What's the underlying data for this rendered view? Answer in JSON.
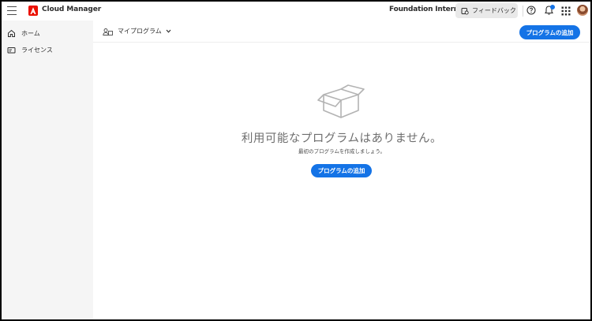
{
  "header": {
    "app_title": "Cloud Manager",
    "org_name": "Foundation Internal",
    "feedback_label": "フィードバック"
  },
  "sidebar": {
    "items": [
      {
        "label": "ホーム",
        "icon": "home-icon"
      },
      {
        "label": "ライセンス",
        "icon": "license-icon"
      }
    ]
  },
  "subbar": {
    "program_selector_label": "マイプログラム",
    "add_program_label": "プログラムの追加"
  },
  "empty_state": {
    "heading": "利用可能なプログラムはありません。",
    "subtext": "最初のプログラムを作成しましょう。",
    "add_program_label": "プログラムの追加"
  },
  "colors": {
    "accent": "#1473e6",
    "brand": "#eb1000",
    "notification_dot": "#1473e6"
  }
}
